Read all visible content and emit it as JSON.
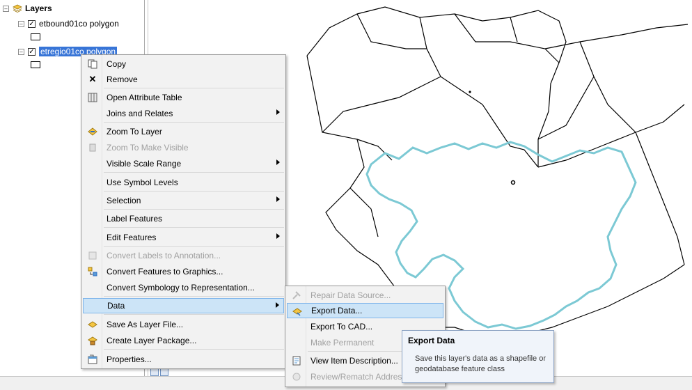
{
  "toc": {
    "root_label": "Layers",
    "layers": [
      {
        "name": "etbound01co polygon",
        "checked": true,
        "selected": false
      },
      {
        "name": "etregio01co polygon",
        "checked": true,
        "selected": true
      }
    ],
    "checked_mark": "✓",
    "collapse_mark": "–"
  },
  "context_menu": {
    "items": [
      {
        "label": "Copy",
        "icon": "copy-icon",
        "enabled": true
      },
      {
        "label": "Remove",
        "icon": "remove-icon",
        "enabled": true
      },
      {
        "label": "Open Attribute Table",
        "icon": "table-icon",
        "enabled": true
      },
      {
        "label": "Joins and Relates",
        "icon": "",
        "enabled": true,
        "submenu": true
      },
      {
        "label": "Zoom To Layer",
        "icon": "zoom-to-layer-icon",
        "enabled": true
      },
      {
        "label": "Zoom To Make Visible",
        "icon": "zoom-to-visible-icon",
        "enabled": false
      },
      {
        "label": "Visible Scale Range",
        "icon": "",
        "enabled": true,
        "submenu": true
      },
      {
        "label": "Use Symbol Levels",
        "icon": "",
        "enabled": true
      },
      {
        "label": "Selection",
        "icon": "",
        "enabled": true,
        "submenu": true
      },
      {
        "label": "Label Features",
        "icon": "",
        "enabled": true
      },
      {
        "label": "Edit Features",
        "icon": "",
        "enabled": true,
        "submenu": true
      },
      {
        "label": "Convert Labels to Annotation...",
        "icon": "convert-labels-icon",
        "enabled": false
      },
      {
        "label": "Convert Features to Graphics...",
        "icon": "convert-graphics-icon",
        "enabled": true
      },
      {
        "label": "Convert Symbology to Representation...",
        "icon": "",
        "enabled": true
      },
      {
        "label": "Data",
        "icon": "",
        "enabled": true,
        "submenu": true,
        "highlighted": true
      },
      {
        "label": "Save As Layer File...",
        "icon": "layer-file-icon",
        "enabled": true
      },
      {
        "label": "Create Layer Package...",
        "icon": "layer-package-icon",
        "enabled": true
      },
      {
        "label": "Properties...",
        "icon": "properties-icon",
        "enabled": true
      }
    ]
  },
  "data_submenu": {
    "items": [
      {
        "label": "Repair Data Source...",
        "icon": "repair-icon",
        "enabled": false
      },
      {
        "label": "Export Data...",
        "icon": "export-data-icon",
        "enabled": true,
        "highlighted": true
      },
      {
        "label": "Export To CAD...",
        "icon": "",
        "enabled": true
      },
      {
        "label": "Make Permanent",
        "icon": "",
        "enabled": false
      },
      {
        "label": "View Item Description...",
        "icon": "item-description-icon",
        "enabled": true
      },
      {
        "label": "Review/Rematch Addresses...",
        "icon": "rematch-icon",
        "enabled": false
      }
    ]
  },
  "tooltip": {
    "title": "Export Data",
    "body": "Save this layer's data as a shapefile or geodatabase feature class"
  },
  "colors": {
    "selection_blue": "#3875d7",
    "menu_highlight": "#cce4f7",
    "region_outline": "#7cc9d4",
    "boundary_outline": "#000000"
  }
}
